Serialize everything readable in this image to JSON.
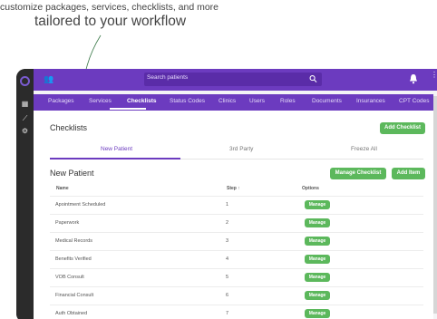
{
  "caption": {
    "line1": "customize packages, services, checklists, and more",
    "line2": "tailored to your workflow"
  },
  "topbar": {
    "search_placeholder": "Search patients",
    "more": "⋮"
  },
  "tabs": [
    {
      "label": "Packages",
      "active": false
    },
    {
      "label": "Services",
      "active": false
    },
    {
      "label": "Checklists",
      "active": true
    },
    {
      "label": "Status Codes",
      "active": false
    },
    {
      "label": "Clinics",
      "active": false
    },
    {
      "label": "Users",
      "active": false
    },
    {
      "label": "Roles",
      "active": false
    },
    {
      "label": "Documents",
      "active": false
    },
    {
      "label": "Insurances",
      "active": false
    },
    {
      "label": "CPT Codes",
      "active": false
    }
  ],
  "checklists": {
    "title": "Checklists",
    "add_checklist": "Add Checklist",
    "subtabs": [
      {
        "label": "New Patient",
        "active": true
      },
      {
        "label": "3rd Party",
        "active": false
      },
      {
        "label": "Freeze All",
        "active": false
      }
    ]
  },
  "list": {
    "title": "New Patient",
    "manage_checklist": "Manage Checklist",
    "add_item": "Add Item",
    "columns": {
      "name": "Name",
      "step": "Step",
      "sort_indicator": "↑",
      "options": "Options"
    },
    "rows": [
      {
        "name": "Apointment Scheduled",
        "step": "1",
        "action": "Manage"
      },
      {
        "name": "Paperwork",
        "step": "2",
        "action": "Manage"
      },
      {
        "name": "Medical Records",
        "step": "3",
        "action": "Manage"
      },
      {
        "name": "Benefits Verified",
        "step": "4",
        "action": "Manage"
      },
      {
        "name": "VOB Consult",
        "step": "5",
        "action": "Manage"
      },
      {
        "name": "Financial Consult",
        "step": "6",
        "action": "Manage"
      },
      {
        "name": "Auth Obtained",
        "step": "7",
        "action": "Manage"
      }
    ]
  },
  "colors": {
    "brand_purple": "#6c3bbf",
    "action_green": "#5cb85c",
    "sidebar": "#2b2b2b"
  },
  "icons": {
    "users": "users-plus-icon",
    "search": "search-icon",
    "bell": "bell-icon",
    "sidebar": [
      "app-logo-icon",
      "grid-icon",
      "chart-icon",
      "gear-icon"
    ]
  }
}
